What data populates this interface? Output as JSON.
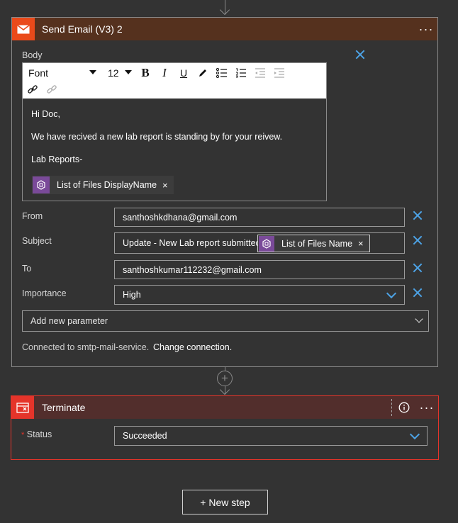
{
  "send_email": {
    "title": "Send Email (V3) 2",
    "menu_label": "···",
    "body_label": "Body",
    "toolbar": {
      "font_label": "Font",
      "size_label": "12",
      "bold": "B",
      "italic": "I",
      "underline": "U"
    },
    "body_lines": [
      "Hi Doc,",
      "We have recived a new lab report is standing by for your reivew.",
      "Lab Reports-"
    ],
    "body_token": "List of Files DisplayName",
    "from_label": "From",
    "from_value": "santhoshkdhana@gmail.com",
    "subject_label": "Subject",
    "subject_value": "Update - New Lab report submitted",
    "subject_token": "List of Files Name",
    "to_label": "To",
    "to_value": "santhoshkumar112232@gmail.com",
    "importance_label": "Importance",
    "importance_value": "High",
    "add_param": "Add new parameter",
    "connected_text": "Connected to smtp-mail-service.",
    "change_connection": "Change connection."
  },
  "terminate": {
    "title": "Terminate",
    "menu_label": "···",
    "required_mark": "*",
    "status_label": "Status",
    "status_value": "Succeeded"
  },
  "new_step_label": "+ New step",
  "colors": {
    "email_header": "#55311e",
    "email_icon_bg": "#ea4a1a",
    "terminate_border": "#e5342a",
    "accent_blue": "#4da3e6",
    "token_purple": "#7a4a99"
  }
}
